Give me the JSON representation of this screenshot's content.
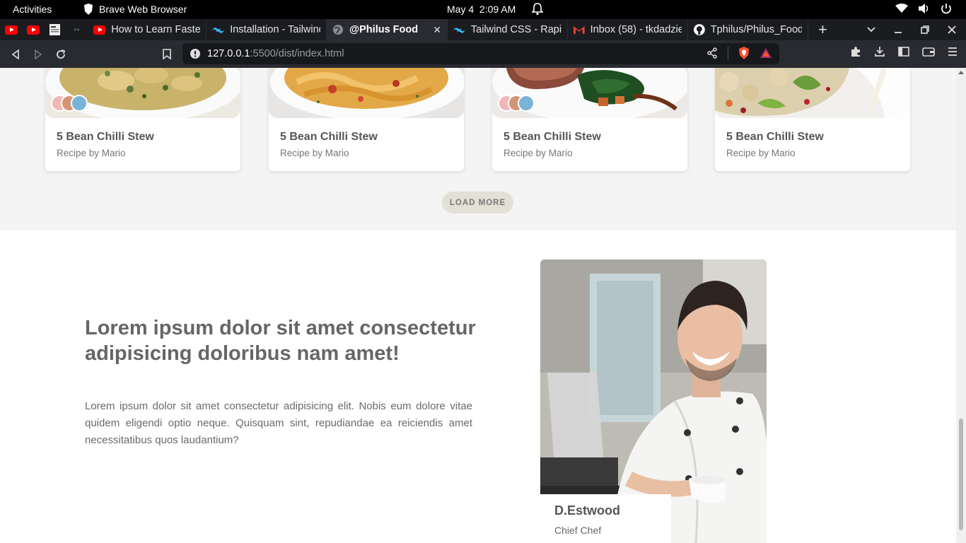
{
  "system": {
    "activities": "Activities",
    "app_name": "Brave Web Browser",
    "date": "May 4",
    "time": "2:09 AM"
  },
  "tabs": [
    {
      "label": "How to Learn Faster",
      "icon": "youtube-icon"
    },
    {
      "label": "Installation - Tailwind",
      "icon": "tailwind-icon"
    },
    {
      "label": "@Philus Food",
      "icon": "globe-icon",
      "active": true
    },
    {
      "label": "Tailwind CSS - Rapid",
      "icon": "tailwind-icon"
    },
    {
      "label": "Inbox (58) - tkdadzie",
      "icon": "gmail-icon"
    },
    {
      "label": "Tphilus/Philus_Food",
      "icon": "github-icon"
    }
  ],
  "url": {
    "host": "127.0.0.1",
    "path": ":5500/dist/index.html"
  },
  "recipes": [
    {
      "title": "5 Bean Chilli Stew",
      "author": "Recipe by Mario"
    },
    {
      "title": "5 Bean Chilli Stew",
      "author": "Recipe by Mario"
    },
    {
      "title": "5 Bean Chilli Stew",
      "author": "Recipe by Mario"
    },
    {
      "title": "5 Bean Chilli Stew",
      "author": "Recipe by Mario"
    }
  ],
  "load_more": "LOAD MORE",
  "hero": {
    "title": "Lorem ipsum dolor sit amet consectetur adipisicing doloribus nam amet!",
    "text": "Lorem ipsum dolor sit amet consectetur adipisicing elit. Nobis eum dolore vitae quidem eligendi optio neque. Quisquam sint, repudiandae ea reiciendis amet necessitatibus quos laudantium?"
  },
  "chef": {
    "name": "D.Estwood",
    "role": "Chief Chef"
  },
  "colors": {
    "tab_bg": "#1b1c20",
    "toolbar_bg": "#2a2b31",
    "button_bg": "#e3e1d6",
    "brave_orange": "#fb542b"
  }
}
